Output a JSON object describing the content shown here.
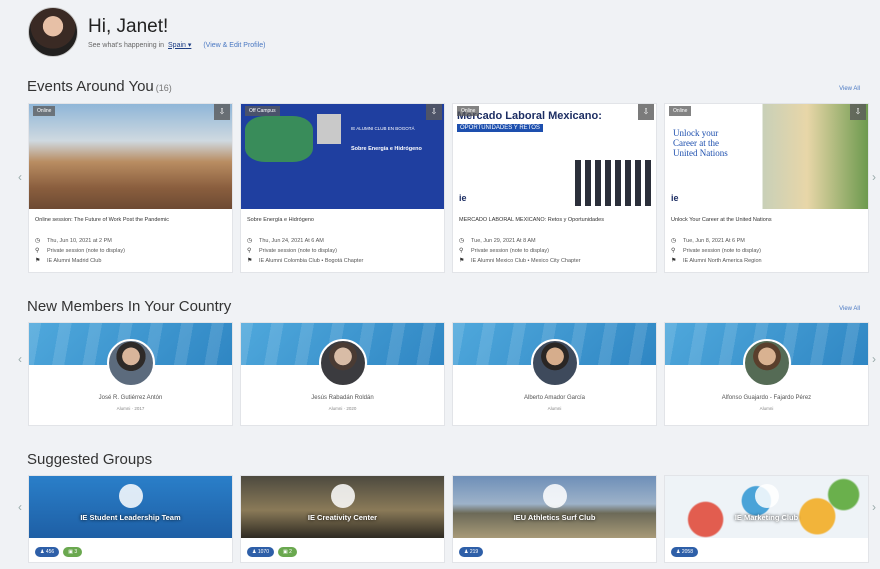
{
  "header": {
    "greeting": "Hi, Janet!",
    "subtitle_prefix": "See what's happening in",
    "location": "Spain",
    "view_profile_link": "(View & Edit Profile)"
  },
  "events": {
    "title": "Events Around You",
    "count": "(16)",
    "view_all": "View All",
    "cards": [
      {
        "badge": "Online",
        "title": "Online session: The Future of Work Post the Pandemic",
        "date": "Thu, Jun 10, 2021 at 2 PM",
        "privacy": "Private session (note to display)",
        "club": "IE Alumni Madrid Club"
      },
      {
        "badge": "Off Campus",
        "title": "Sobre Energía e Hidrógeno",
        "date": "Thu, Jun 24, 2021 At 6 AM",
        "privacy": "Private session (note to display)",
        "club": "IE Alumni Colombia Club • Bogotá Chapter"
      },
      {
        "badge": "Online",
        "title": "MERCADO LABORAL MEXICANO: Retos y Oportunidades",
        "date": "Tue, Jun 29, 2021 At 8 AM",
        "privacy": "Private session (note to display)",
        "club": "IE Alumni Mexico Club • Mexico City Chapter"
      },
      {
        "badge": "Online",
        "title": "Unlock Your Career at the United Nations",
        "date": "Tue, Jun 8, 2021 At 6 PM",
        "privacy": "Private session (note to display)",
        "club": "IE Alumni North America Region"
      }
    ]
  },
  "members": {
    "title": "New Members In Your Country",
    "view_all": "View All",
    "cards": [
      {
        "name": "José R. Gutiérrez Antón",
        "sub": "Alumni · 2017"
      },
      {
        "name": "Jesús Rabadán Roldán",
        "sub": "Alumni · 2020"
      },
      {
        "name": "Alberto Amador García",
        "sub": "Alumni"
      },
      {
        "name": "Alfonso Guajardo - Fajardo Pérez",
        "sub": "Alumni"
      }
    ]
  },
  "groups": {
    "title": "Suggested Groups",
    "cards": [
      {
        "name": "IE Student Leadership Team",
        "members": "456",
        "extra": "3"
      },
      {
        "name": "IE Creativity Center",
        "members": "1070",
        "extra": "2"
      },
      {
        "name": "IEU Athletics Surf Club",
        "members": "219",
        "extra": ""
      },
      {
        "name": "IE Marketing Club",
        "members": "2058",
        "extra": ""
      }
    ]
  },
  "event_images": {
    "card2_line1": "IE ALUMNI CLUB EN BOGOTÁ",
    "card2_line2": "Sobre Energía e Hidrógeno",
    "card3_line1": "Mercado Laboral Mexicano:",
    "card3_line2": "OPORTUNIDADES Y RETOS",
    "card4_line1": "Unlock your",
    "card4_line2": "Career at the",
    "card4_line3": "United Nations"
  },
  "colors": {
    "accent": "#4a78c2",
    "brand_blue": "#2e5fa8",
    "banner_blue": "#3c97d2"
  }
}
